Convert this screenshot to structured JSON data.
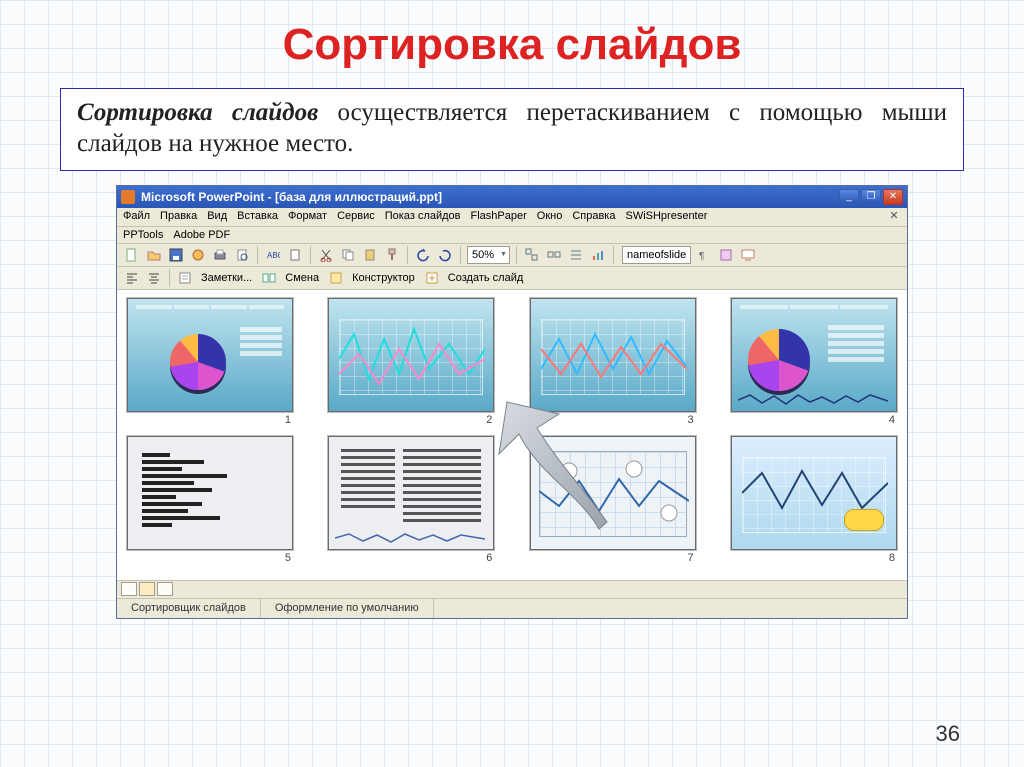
{
  "slide": {
    "title": "Сортировка слайдов",
    "description_bold": "Сортировка слайдов",
    "description_rest": " осуществляется перетаскиванием с помощью мыши слайдов на нужное место.",
    "page_number": "36"
  },
  "powerpoint": {
    "app_title": "Microsoft PowerPoint - [база для иллюстраций.ppt]",
    "menus": [
      "Файл",
      "Правка",
      "Вид",
      "Вставка",
      "Формат",
      "Сервис",
      "Показ слайдов",
      "FlashPaper",
      "Окно",
      "Справка",
      "SWiSHpresenter"
    ],
    "addin_row": [
      "PPTools",
      "Adobe PDF"
    ],
    "zoom": "50%",
    "name_field": "nameofslide",
    "second_toolbar": {
      "notes": "Заметки...",
      "transition": "Смена",
      "design": "Конструктор",
      "new_slide": "Создать слайд"
    },
    "slide_numbers": [
      "1",
      "2",
      "3",
      "4",
      "5",
      "6",
      "7",
      "8"
    ],
    "status": {
      "left": "Сортировщик слайдов",
      "right": "Оформление по умолчанию"
    }
  }
}
